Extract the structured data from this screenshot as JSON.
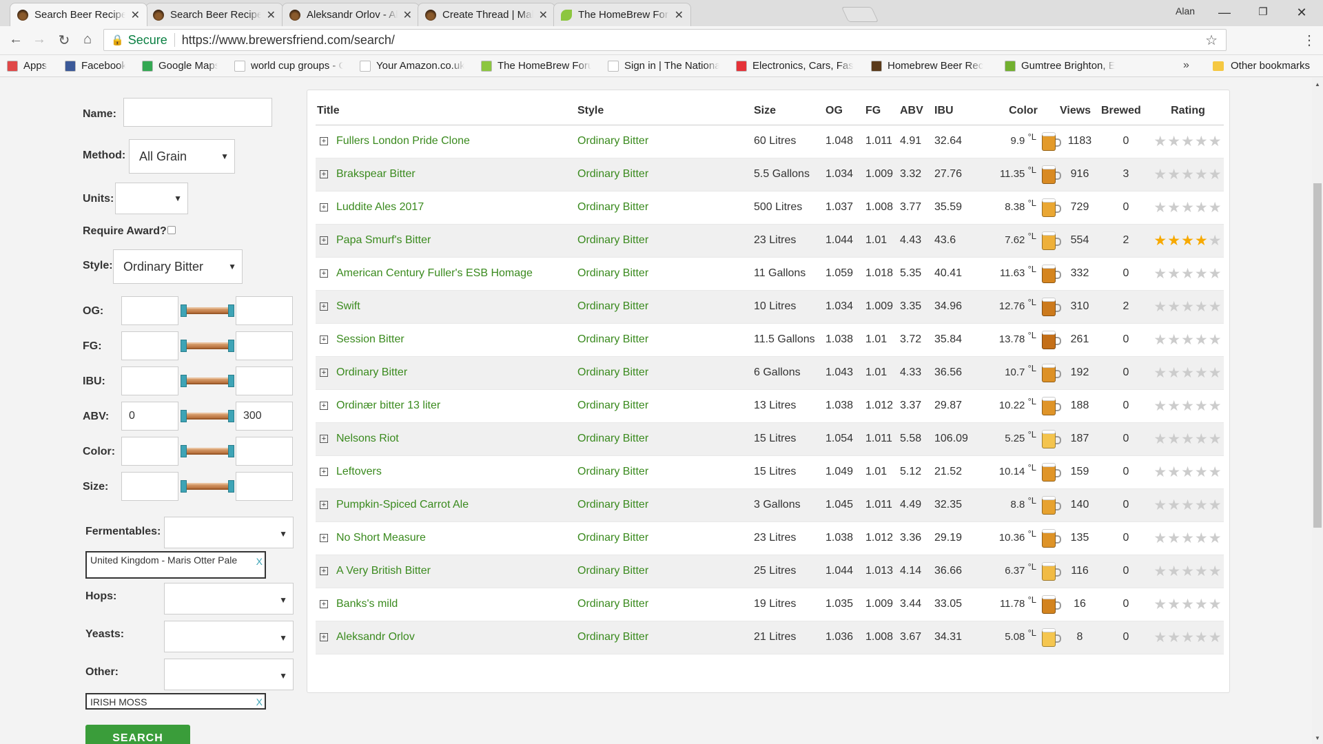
{
  "browser": {
    "tabs": [
      {
        "title": "Search Beer Recipes - Bre",
        "active": true
      },
      {
        "title": "Search Beer Recipes - Bre",
        "active": false
      },
      {
        "title": "Aleksandr Orlov - All Grai",
        "active": false
      },
      {
        "title": "Create Thread | Make Bee",
        "active": false
      },
      {
        "title": "The HomeBrew Forum",
        "active": false
      }
    ],
    "close_glyph": "✕",
    "user": "Alan",
    "secure_label": "Secure",
    "url": "https://www.brewersfriend.com/search/",
    "bookmarks": [
      {
        "label": "Apps",
        "icon": "apps-grid-icon",
        "color": "#e04848"
      },
      {
        "label": "Facebook",
        "icon": "facebook-icon",
        "color": "#3b5998"
      },
      {
        "label": "Google Maps",
        "icon": "google-maps-icon",
        "color": "#34a853"
      },
      {
        "label": "world cup groups - G",
        "icon": "google-icon",
        "color": "#ffffff"
      },
      {
        "label": "Your Amazon.co.uk",
        "icon": "amazon-icon",
        "color": "#ffffff"
      },
      {
        "label": "The HomeBrew Foru",
        "icon": "homebrew-leaf-icon",
        "color": "#8cc63f"
      },
      {
        "label": "Sign in | The Nationa",
        "icon": "national-icon",
        "color": "#ffffff"
      },
      {
        "label": "Electronics, Cars, Fas",
        "icon": "ebay-icon",
        "color": "#e53238"
      },
      {
        "label": "Homebrew Beer Rec",
        "icon": "beer-icon",
        "color": "#5a3a1a"
      },
      {
        "label": "Gumtree Brighton, E",
        "icon": "gumtree-icon",
        "color": "#72b02f"
      }
    ],
    "more_bookmarks": "»",
    "other_bookmarks": "Other bookmarks"
  },
  "filters": {
    "name_label": "Name:",
    "name_value": "",
    "method_label": "Method:",
    "method_value": "All Grain",
    "units_label": "Units:",
    "units_value": "",
    "award_label": "Require Award?",
    "style_label": "Style:",
    "style_value": "Ordinary Bitter",
    "ranges": [
      {
        "label": "OG:",
        "min": "",
        "max": ""
      },
      {
        "label": "FG:",
        "min": "",
        "max": ""
      },
      {
        "label": "IBU:",
        "min": "",
        "max": ""
      },
      {
        "label": "ABV:",
        "min": "0",
        "max": "300"
      },
      {
        "label": "Color:",
        "min": "",
        "max": ""
      },
      {
        "label": "Size:",
        "min": "",
        "max": ""
      }
    ],
    "fermentables_label": "Fermentables:",
    "fermentable_tag": "United Kingdom - Maris Otter Pale",
    "hops_label": "Hops:",
    "yeasts_label": "Yeasts:",
    "other_label": "Other:",
    "other_tag": "IRISH MOSS",
    "tag_remove": "X",
    "search_button": "SEARCH"
  },
  "results": {
    "headers": [
      "Title",
      "Style",
      "Size",
      "OG",
      "FG",
      "ABV",
      "IBU",
      "Color",
      "Views",
      "Brewed",
      "Rating"
    ],
    "color_unit": "°L",
    "rows": [
      {
        "title": "Fullers London Pride Clone",
        "style": "Ordinary Bitter",
        "size": "60 Litres",
        "og": "1.048",
        "fg": "1.011",
        "abv": "4.91",
        "ibu": "32.64",
        "color": "9.9",
        "mug": "#e39a2a",
        "views": "1183",
        "brewed": "0",
        "rating": 0
      },
      {
        "title": "Brakspear Bitter",
        "style": "Ordinary Bitter",
        "size": "5.5 Gallons",
        "og": "1.034",
        "fg": "1.009",
        "abv": "3.32",
        "ibu": "27.76",
        "color": "11.35",
        "mug": "#d98a22",
        "views": "916",
        "brewed": "3",
        "rating": 0
      },
      {
        "title": "Luddite Ales 2017",
        "style": "Ordinary Bitter",
        "size": "500 Litres",
        "og": "1.037",
        "fg": "1.008",
        "abv": "3.77",
        "ibu": "35.59",
        "color": "8.38",
        "mug": "#eaa733",
        "views": "729",
        "brewed": "0",
        "rating": 0
      },
      {
        "title": "Papa Smurf's Bitter",
        "style": "Ordinary Bitter",
        "size": "23 Litres",
        "og": "1.044",
        "fg": "1.01",
        "abv": "4.43",
        "ibu": "43.6",
        "color": "7.62",
        "mug": "#eeb03a",
        "views": "554",
        "brewed": "2",
        "rating": 4
      },
      {
        "title": "American Century Fuller's ESB Homage",
        "style": "Ordinary Bitter",
        "size": "11 Gallons",
        "og": "1.059",
        "fg": "1.018",
        "abv": "5.35",
        "ibu": "40.41",
        "color": "11.63",
        "mug": "#d5851f",
        "views": "332",
        "brewed": "0",
        "rating": 0
      },
      {
        "title": "Swift",
        "style": "Ordinary Bitter",
        "size": "10 Litres",
        "og": "1.034",
        "fg": "1.009",
        "abv": "3.35",
        "ibu": "34.96",
        "color": "12.76",
        "mug": "#cc7a1c",
        "views": "310",
        "brewed": "2",
        "rating": 0
      },
      {
        "title": "Session Bitter",
        "style": "Ordinary Bitter",
        "size": "11.5 Gallons",
        "og": "1.038",
        "fg": "1.01",
        "abv": "3.72",
        "ibu": "35.84",
        "color": "13.78",
        "mug": "#c46f18",
        "views": "261",
        "brewed": "0",
        "rating": 0
      },
      {
        "title": "Ordinary Bitter",
        "style": "Ordinary Bitter",
        "size": "6 Gallons",
        "og": "1.043",
        "fg": "1.01",
        "abv": "4.33",
        "ibu": "36.56",
        "color": "10.7",
        "mug": "#dd9126",
        "views": "192",
        "brewed": "0",
        "rating": 0
      },
      {
        "title": "Ordinær bitter 13 liter",
        "style": "Ordinary Bitter",
        "size": "13 Litres",
        "og": "1.038",
        "fg": "1.012",
        "abv": "3.37",
        "ibu": "29.87",
        "color": "10.22",
        "mug": "#df9428",
        "views": "188",
        "brewed": "0",
        "rating": 0
      },
      {
        "title": "Nelsons Riot",
        "style": "Ordinary Bitter",
        "size": "15 Litres",
        "og": "1.054",
        "fg": "1.011",
        "abv": "5.58",
        "ibu": "106.09",
        "color": "5.25",
        "mug": "#f4c44e",
        "views": "187",
        "brewed": "0",
        "rating": 0
      },
      {
        "title": "Leftovers",
        "style": "Ordinary Bitter",
        "size": "15 Litres",
        "og": "1.049",
        "fg": "1.01",
        "abv": "5.12",
        "ibu": "21.52",
        "color": "10.14",
        "mug": "#e09528",
        "views": "159",
        "brewed": "0",
        "rating": 0
      },
      {
        "title": "Pumpkin-Spiced Carrot Ale",
        "style": "Ordinary Bitter",
        "size": "3 Gallons",
        "og": "1.045",
        "fg": "1.011",
        "abv": "4.49",
        "ibu": "32.35",
        "color": "8.8",
        "mug": "#e7a22f",
        "views": "140",
        "brewed": "0",
        "rating": 0
      },
      {
        "title": "No Short Measure",
        "style": "Ordinary Bitter",
        "size": "23 Litres",
        "og": "1.038",
        "fg": "1.012",
        "abv": "3.36",
        "ibu": "29.19",
        "color": "10.36",
        "mug": "#de9327",
        "views": "135",
        "brewed": "0",
        "rating": 0
      },
      {
        "title": "A Very British Bitter",
        "style": "Ordinary Bitter",
        "size": "25 Litres",
        "og": "1.044",
        "fg": "1.013",
        "abv": "4.14",
        "ibu": "36.66",
        "color": "6.37",
        "mug": "#f1bb45",
        "views": "116",
        "brewed": "0",
        "rating": 0
      },
      {
        "title": "Banks's mild",
        "style": "Ordinary Bitter",
        "size": "19 Litres",
        "og": "1.035",
        "fg": "1.009",
        "abv": "3.44",
        "ibu": "33.05",
        "color": "11.78",
        "mug": "#d3831e",
        "views": "16",
        "brewed": "0",
        "rating": 0
      },
      {
        "title": "Aleksandr Orlov",
        "style": "Ordinary Bitter",
        "size": "21 Litres",
        "og": "1.036",
        "fg": "1.008",
        "abv": "3.67",
        "ibu": "34.31",
        "color": "5.08",
        "mug": "#f5c650",
        "views": "8",
        "brewed": "0",
        "rating": 0
      }
    ]
  }
}
